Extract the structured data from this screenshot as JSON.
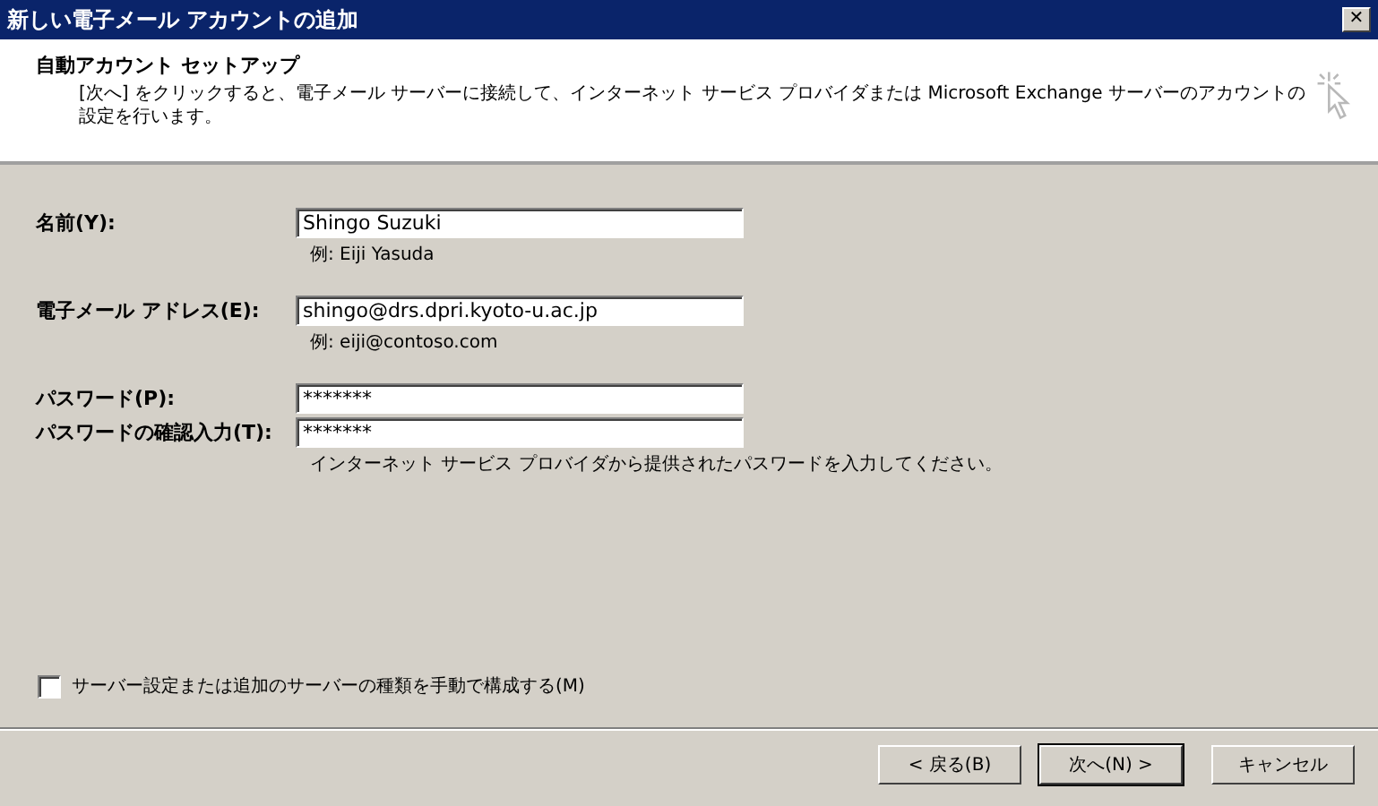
{
  "window": {
    "title": "新しい電子メール アカウントの追加",
    "close": "✕"
  },
  "header": {
    "title": "自動アカウント セットアップ",
    "description": "[次へ] をクリックすると、電子メール サーバーに接続して、インターネット サービス プロバイダまたは Microsoft Exchange サーバーのアカウントの設定を行います。"
  },
  "fields": [
    {
      "label": "名前(Y):",
      "value": "Shingo Suzuki",
      "hint": "例: Eiji Yasuda"
    },
    {
      "label": "電子メール アドレス(E):",
      "value": "shingo@drs.dpri.kyoto-u.ac.jp",
      "hint": "例: eiji@contoso.com"
    },
    {
      "label": "パスワード(P):",
      "value": "*******"
    },
    {
      "label": "パスワードの確認入力(T):",
      "value": "*******",
      "hint": "インターネット サービス プロバイダから提供されたパスワードを入力してください。"
    }
  ],
  "manual_setup": {
    "label": "サーバー設定または追加のサーバーの種類を手動で構成する(M)",
    "checked": false
  },
  "buttons": [
    {
      "label": "< 戻る(B)",
      "default": false
    },
    {
      "label": "次へ(N) >",
      "default": true
    },
    {
      "label": "キャンセル",
      "default": false
    }
  ]
}
